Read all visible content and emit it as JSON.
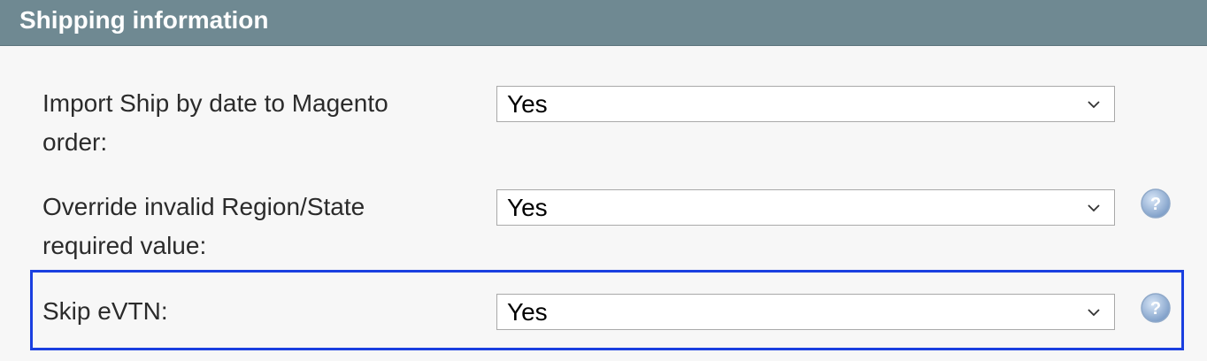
{
  "section": {
    "title": "Shipping information"
  },
  "fields": [
    {
      "label_line1": "Import Ship by date to Magento",
      "label_line2": "order:",
      "value": "Yes",
      "help_icon": false
    },
    {
      "label_line1": "Override invalid Region/State",
      "label_line2": "required value:",
      "value": "Yes",
      "help_icon": true
    },
    {
      "label_line1": "Skip eVTN:",
      "value": "Yes",
      "help_icon": true
    }
  ],
  "icons": {
    "dropdown": "chevron-down-icon",
    "help": "help-icon"
  },
  "colors": {
    "header_bg": "#6f8992",
    "highlight_border": "#1a3fe0"
  }
}
